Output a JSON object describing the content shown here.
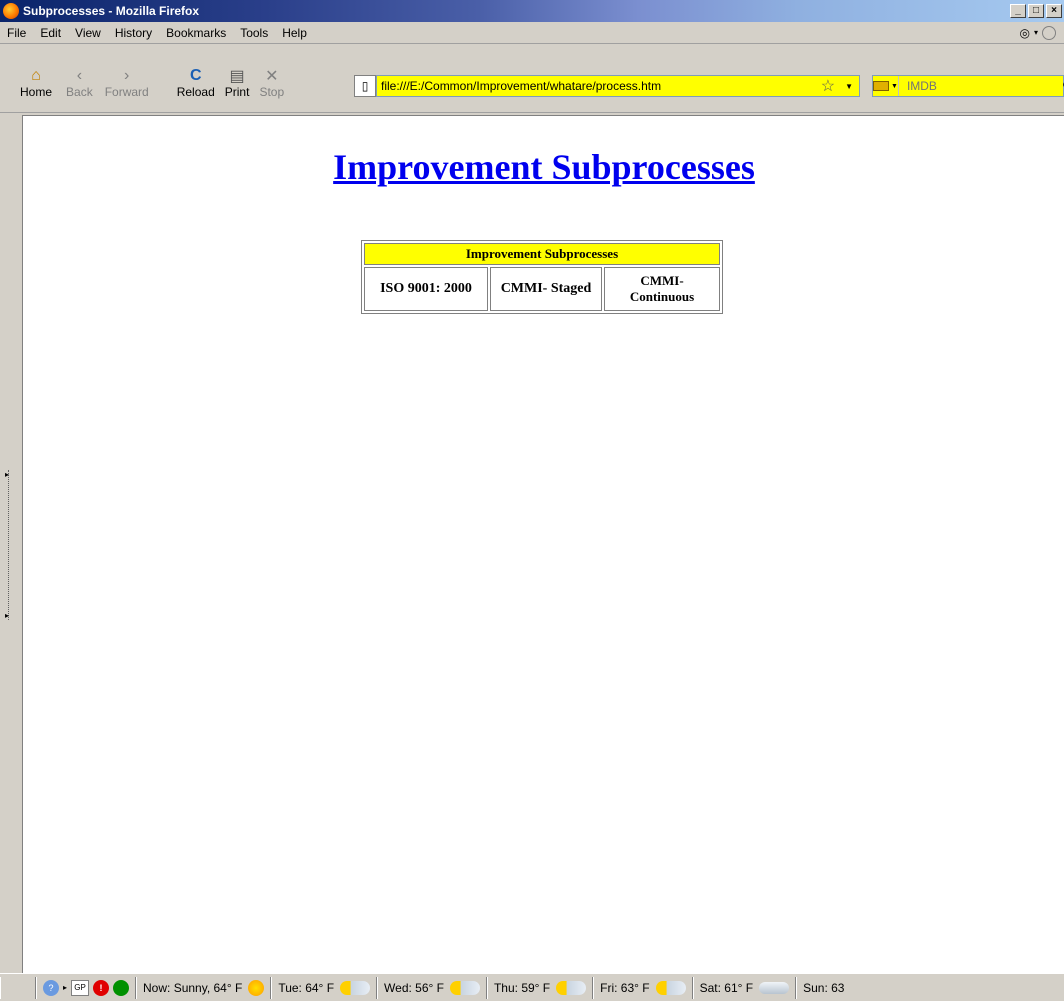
{
  "window": {
    "title": "Subprocesses - Mozilla Firefox"
  },
  "menu": [
    "File",
    "Edit",
    "View",
    "History",
    "Bookmarks",
    "Tools",
    "Help"
  ],
  "toolbar": {
    "home": "Home",
    "back": "Back",
    "forward": "Forward",
    "reload": "Reload",
    "print": "Print",
    "stop": "Stop"
  },
  "urlbar": {
    "url": "file:///E:/Common/Improvement/whatare/process.htm"
  },
  "search": {
    "placeholder": "IMDB"
  },
  "page": {
    "title": "Improvement Subprocesses",
    "table": {
      "header": "Improvement Subprocesses",
      "cells": [
        "ISO 9001: 2000",
        "CMMI- Staged",
        "CMMI- Continuous"
      ]
    }
  },
  "statusbar": {
    "gp": "GP",
    "weather": [
      {
        "label": "Now: Sunny, 64° F",
        "icon": "sun-icon"
      },
      {
        "label": "Tue: 64° F",
        "icon": "partly-cloudy-icon"
      },
      {
        "label": "Wed: 56° F",
        "icon": "partly-cloudy-icon"
      },
      {
        "label": "Thu: 59° F",
        "icon": "partly-cloudy-icon"
      },
      {
        "label": "Fri: 63° F",
        "icon": "partly-cloudy-icon"
      },
      {
        "label": "Sat: 61° F",
        "icon": "cloud-icon"
      },
      {
        "label": "Sun: 63",
        "icon": ""
      }
    ]
  }
}
